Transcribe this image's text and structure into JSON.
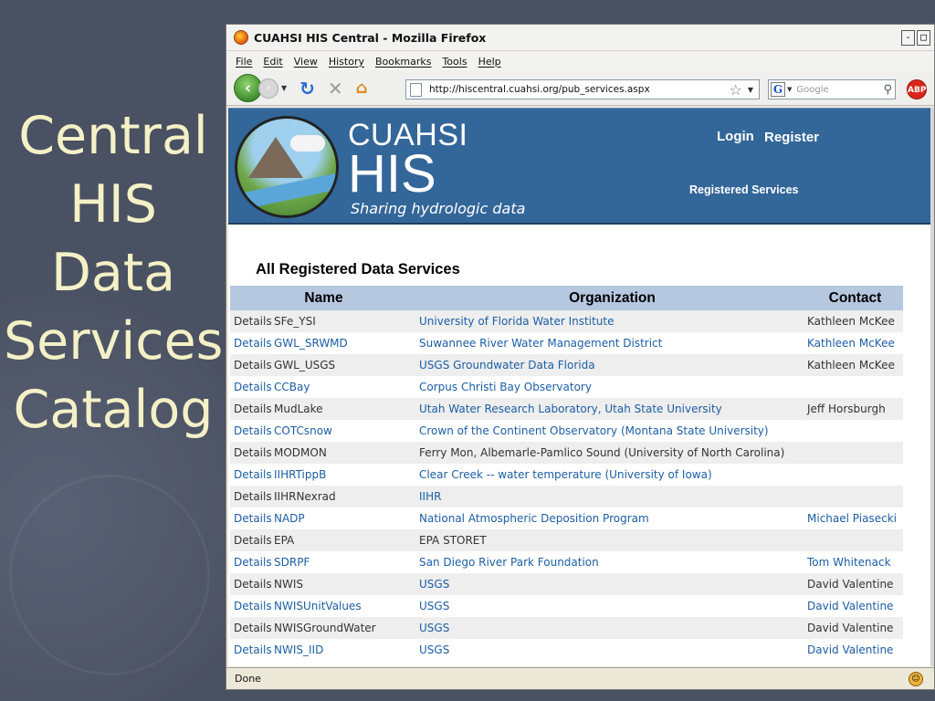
{
  "slide": {
    "title_lines": [
      "Central",
      "HIS",
      "Data",
      "Services",
      "Catalog"
    ]
  },
  "browser": {
    "title": "CUAHSI HIS Central - Mozilla Firefox",
    "window_buttons": [
      "-",
      "□"
    ],
    "menu": [
      "File",
      "Edit",
      "View",
      "History",
      "Bookmarks",
      "Tools",
      "Help"
    ],
    "url": "http://hiscentral.cuahsi.org/pub_services.aspx",
    "search_placeholder": "Google",
    "search_engine_icon": "G",
    "adblock_label": "ABP",
    "status": "Done"
  },
  "site": {
    "brand_name": "CUAHSI",
    "brand_his": "HIS",
    "tagline": "Sharing hydrologic data",
    "login": "Login",
    "register": "Register",
    "registered_services": "Registered Services",
    "accent_color": "#336699"
  },
  "services": {
    "section_title": "All Registered Data Services",
    "columns": [
      "Name",
      "Organization",
      "Contact"
    ],
    "details_label": "Details",
    "rows": [
      {
        "name": "SFe_YSI",
        "org": "University of Florida Water Institute",
        "contact": "Kathleen McKee",
        "name_link": false,
        "org_link": true,
        "contact_link": false
      },
      {
        "name": "GWL_SRWMD",
        "org": "Suwannee River Water Management District",
        "contact": "Kathleen McKee",
        "name_link": true,
        "org_link": true,
        "contact_link": true
      },
      {
        "name": "GWL_USGS",
        "org": "USGS Groundwater Data Florida",
        "contact": "Kathleen McKee",
        "name_link": false,
        "org_link": true,
        "contact_link": false
      },
      {
        "name": "CCBay",
        "org": "Corpus Christi Bay Observatory",
        "contact": "",
        "name_link": true,
        "org_link": true,
        "contact_link": false
      },
      {
        "name": "MudLake",
        "org": "Utah Water Research Laboratory, Utah State University",
        "contact": "Jeff Horsburgh",
        "name_link": false,
        "org_link": true,
        "contact_link": false
      },
      {
        "name": "COTCsnow",
        "org": "Crown of the Continent Observatory (Montana State University)",
        "contact": "",
        "name_link": true,
        "org_link": true,
        "contact_link": false
      },
      {
        "name": "MODMON",
        "org": "Ferry Mon, Albemarle-Pamlico Sound (University of North Carolina)",
        "contact": "",
        "name_link": false,
        "org_link": false,
        "contact_link": false
      },
      {
        "name": "IIHRTippB",
        "org": "Clear Creek -- water temperature (University of Iowa)",
        "contact": "",
        "name_link": true,
        "org_link": true,
        "contact_link": false
      },
      {
        "name": "IIHRNexrad",
        "org": "IIHR",
        "contact": "",
        "name_link": false,
        "org_link": true,
        "contact_link": false
      },
      {
        "name": "NADP",
        "org": "National Atmospheric Deposition Program",
        "contact": "Michael Piasecki",
        "name_link": true,
        "org_link": true,
        "contact_link": true
      },
      {
        "name": "EPA",
        "org": "EPA STORET",
        "contact": "",
        "name_link": false,
        "org_link": false,
        "contact_link": false
      },
      {
        "name": "SDRPF",
        "org": "San Diego River Park Foundation",
        "contact": "Tom Whitenack",
        "name_link": true,
        "org_link": true,
        "contact_link": true
      },
      {
        "name": "NWIS",
        "org": "USGS",
        "contact": "David Valentine",
        "name_link": false,
        "org_link": true,
        "contact_link": false
      },
      {
        "name": "NWISUnitValues",
        "org": "USGS",
        "contact": "David Valentine",
        "name_link": true,
        "org_link": true,
        "contact_link": true
      },
      {
        "name": "NWISGroundWater",
        "org": "USGS",
        "contact": "David Valentine",
        "name_link": false,
        "org_link": true,
        "contact_link": false
      },
      {
        "name": "NWIS_IID",
        "org": "USGS",
        "contact": "David Valentine",
        "name_link": true,
        "org_link": true,
        "contact_link": true
      }
    ]
  }
}
